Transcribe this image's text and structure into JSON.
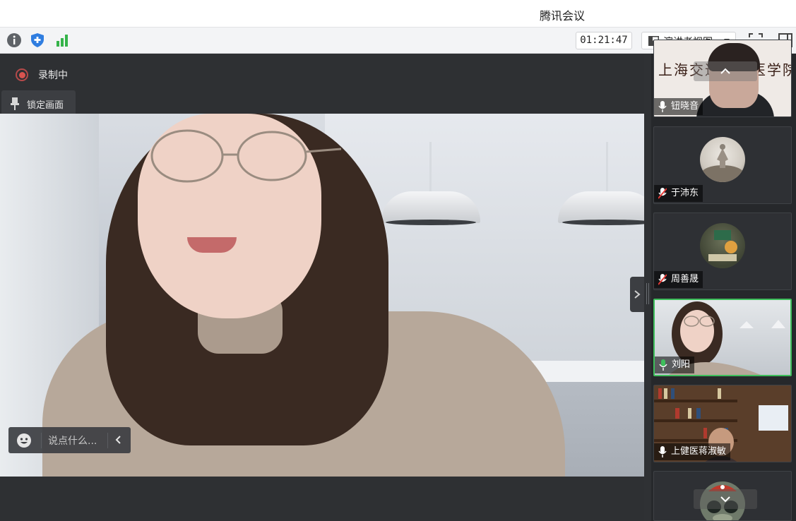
{
  "window": {
    "title": "腾讯会议"
  },
  "toolbar": {
    "icons": [
      "info-icon",
      "shield-icon",
      "signal-icon"
    ],
    "timer": "01:21:47",
    "view_label": "演讲者视图",
    "fullscreen_icon": "fullscreen-icon",
    "sidebar_icon": "sidebar-toggle-icon"
  },
  "main": {
    "recording_label": "录制中",
    "lock_label": "锁定画面",
    "chat_placeholder": "说点什么..."
  },
  "participants": [
    {
      "name": "钮晓音",
      "mic": "on",
      "type": "video",
      "overlay_text": "上海交通大学医学院"
    },
    {
      "name": "于沛东",
      "mic": "muted",
      "type": "avatar"
    },
    {
      "name": "周善晟",
      "mic": "muted",
      "type": "avatar"
    },
    {
      "name": "刘阳",
      "mic": "speaking",
      "type": "video",
      "active": true
    },
    {
      "name": "上健医蒋淑敏",
      "mic": "on",
      "type": "video"
    },
    {
      "name": "",
      "mic": "",
      "type": "avatar"
    }
  ],
  "colors": {
    "active_speaker": "#3dbe5b",
    "recording": "#d9534f",
    "shield": "#2f7de0",
    "signal": "#35b34a"
  }
}
